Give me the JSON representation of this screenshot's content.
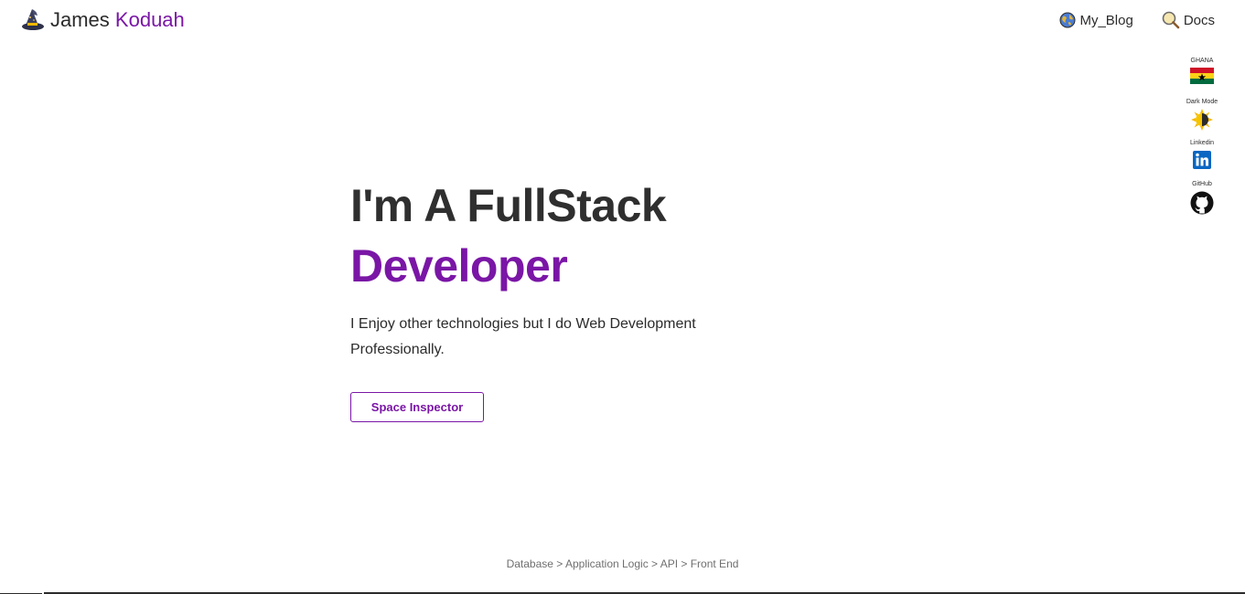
{
  "header": {
    "logo_first": "James",
    "logo_second": "Koduah",
    "nav": [
      {
        "label": "My_Blog",
        "icon": "globe-icon"
      },
      {
        "label": "Docs",
        "icon": "magnifier-icon"
      }
    ]
  },
  "social": [
    {
      "label": "GHANA",
      "icon": "ghana-flag-icon"
    },
    {
      "label": "Dark Mode",
      "icon": "sun-moon-icon"
    },
    {
      "label": "Linkedin",
      "icon": "linkedin-icon"
    },
    {
      "label": "GitHub",
      "icon": "github-icon"
    }
  ],
  "hero": {
    "title_line1": "I'm A FullStack",
    "title_line2": "Developer",
    "subtitle": "I Enjoy other technologies but I do Web Development Professionally.",
    "cta_label": "Space Inspector"
  },
  "footer": {
    "breadcrumb": "Database > Application Logic > API > Front End"
  },
  "colors": {
    "accent": "#7a16a6",
    "text": "#2b2b2b",
    "muted": "#6f6f6f"
  }
}
